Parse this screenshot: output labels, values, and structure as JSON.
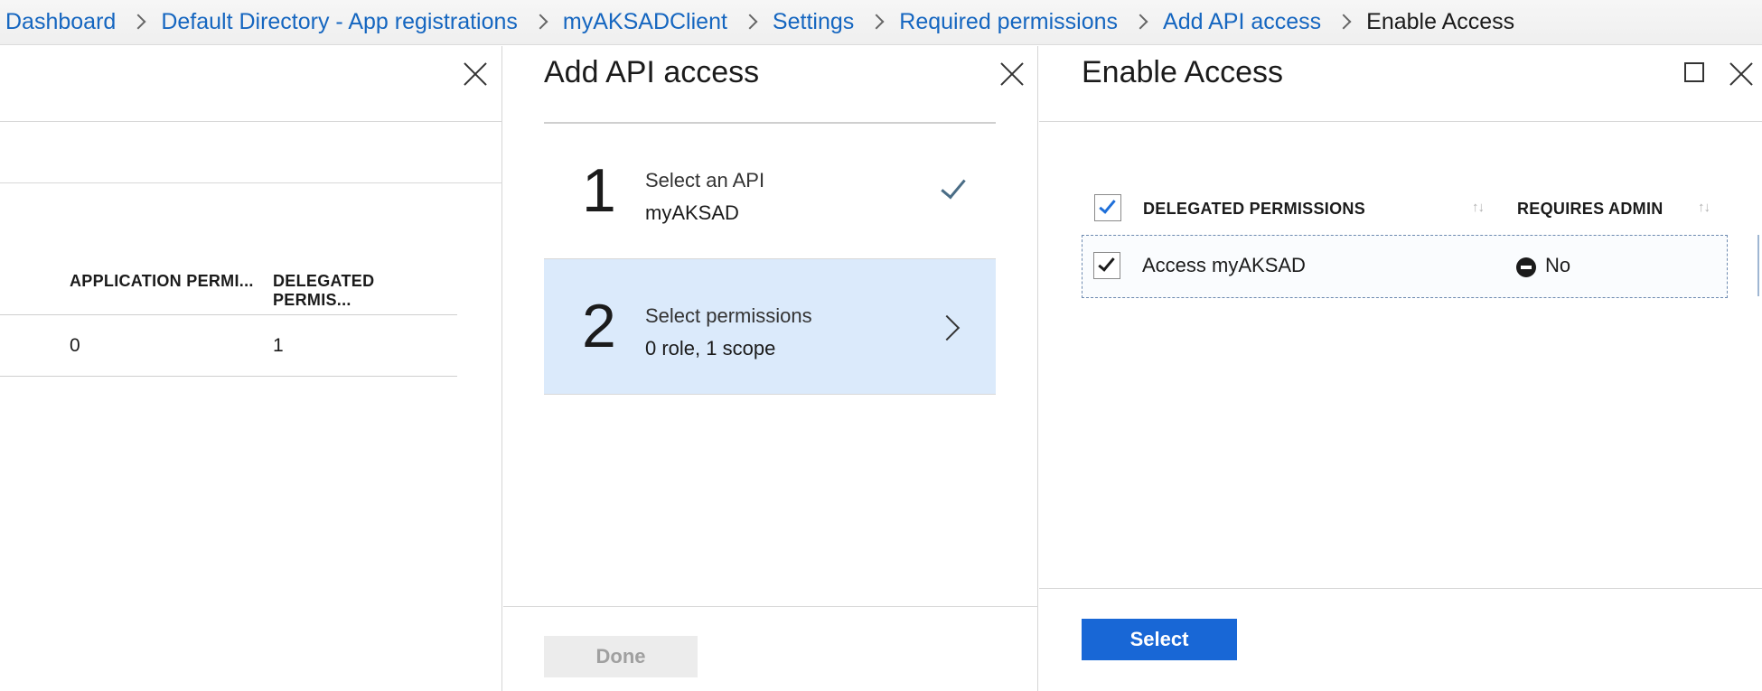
{
  "breadcrumb": {
    "items": [
      "Dashboard",
      "Default Directory - App registrations",
      "myAKSADClient",
      "Settings",
      "Required permissions",
      "Add API access"
    ],
    "current": "Enable Access"
  },
  "left_panel": {
    "table": {
      "headers": [
        "APPLICATION PERMI...",
        "DELEGATED PERMIS..."
      ],
      "row": [
        "0",
        "1"
      ]
    }
  },
  "mid_panel": {
    "title": "Add API access",
    "steps": [
      {
        "number": "1",
        "title": "Select an API",
        "subtitle": "myAKSAD",
        "status_icon": "check-icon"
      },
      {
        "number": "2",
        "title": "Select permissions",
        "subtitle": "0 role, 1 scope",
        "status_icon": "chevron-right-icon"
      }
    ],
    "done_label": "Done"
  },
  "right_panel": {
    "title": "Enable Access",
    "table": {
      "headers": [
        "DELEGATED PERMISSIONS",
        "REQUIRES ADMIN"
      ],
      "sort_glyph": "↑↓",
      "rows": [
        {
          "permission": "Access myAKSAD",
          "requires_admin": "No",
          "checked": true
        }
      ]
    },
    "select_label": "Select"
  },
  "colors": {
    "link": "#1566c0",
    "active_step": "#dbeafb",
    "primary_button": "#1867d6",
    "check_blue": "#1e6fd9"
  }
}
